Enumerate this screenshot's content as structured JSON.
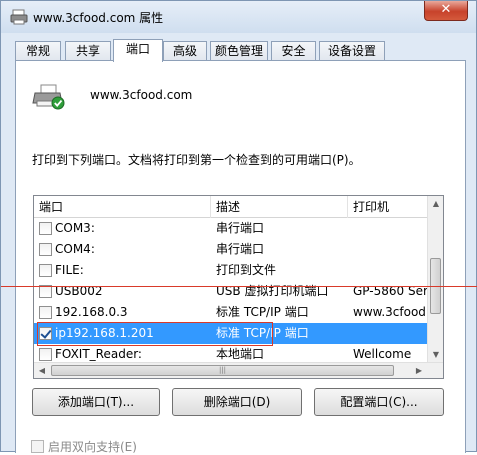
{
  "window": {
    "title": "www.3cfood.com 属性",
    "close_label": "✕"
  },
  "tabs": [
    "常规",
    "共享",
    "端口",
    "高级",
    "颜色管理",
    "安全",
    "设备设置"
  ],
  "active_tab": "端口",
  "printer": {
    "name": "www.3cfood.com"
  },
  "instruction": "打印到下列端口。文档将打印到第一个检查到的可用端口(P)。",
  "columns": [
    "端口",
    "描述",
    "打印机"
  ],
  "rows": [
    {
      "checked": false,
      "port": "COM3:",
      "desc": "串行端口",
      "printer": ""
    },
    {
      "checked": false,
      "port": "COM4:",
      "desc": "串行端口",
      "printer": ""
    },
    {
      "checked": false,
      "port": "FILE:",
      "desc": "打印到文件",
      "printer": ""
    },
    {
      "checked": false,
      "port": "USB002",
      "desc": "USB 虚拟打印机端口",
      "printer": "GP-5860 Ser"
    },
    {
      "checked": false,
      "port": "192.168.0.3",
      "desc": "标准 TCP/IP 端口",
      "printer": "www.3cfood."
    },
    {
      "checked": true,
      "port": "ip192.168.1.201",
      "desc": "标准 TCP/IP 端口",
      "printer": ""
    },
    {
      "checked": false,
      "port": "FOXIT_Reader:",
      "desc": "本地端口",
      "printer": "Wellcome"
    }
  ],
  "selected_row": 5,
  "scroll_hint": "|||",
  "buttons": {
    "add": "添加端口(T)...",
    "delete": "删除端口(D)",
    "configure": "配置端口(C)..."
  },
  "bidirectional": "启用双向支持(E)",
  "colors": {
    "selection": "#3399ff",
    "annotation": "#d93a2a",
    "window_bg": "#dfe9f5"
  }
}
